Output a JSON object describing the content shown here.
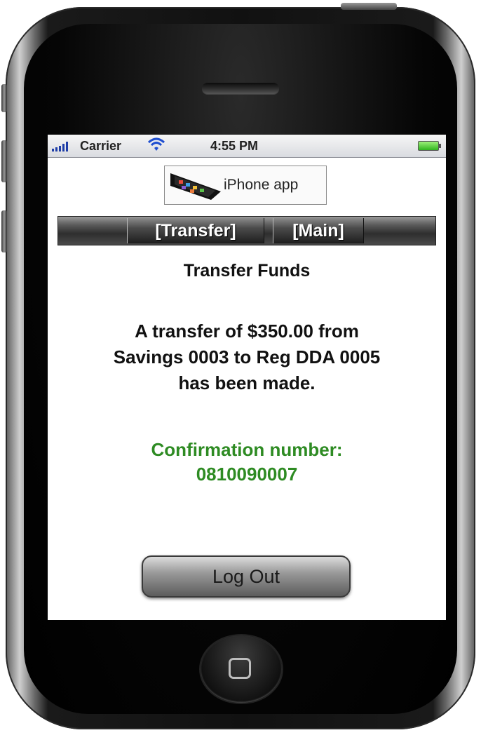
{
  "status_bar": {
    "carrier": "Carrier",
    "time": "4:55 PM"
  },
  "logo": {
    "text": "iPhone app"
  },
  "nav": {
    "transfer_label": "[Transfer]",
    "main_label": "[Main]"
  },
  "page": {
    "title": "Transfer Funds",
    "message_line1": "A transfer of $350.00 from",
    "message_line2": "Savings 0003 to Reg DDA 0005",
    "message_line3": "has been made.",
    "confirmation_label": "Confirmation number:",
    "confirmation_number": "0810090007"
  },
  "actions": {
    "logout_label": "Log Out"
  },
  "colors": {
    "confirmation_green": "#2e8b23",
    "nav_dark": "#2e2e2e"
  },
  "icons": {
    "signal": "signal-bars-icon",
    "wifi": "wifi-icon",
    "battery": "battery-icon",
    "home": "home-button-icon"
  }
}
